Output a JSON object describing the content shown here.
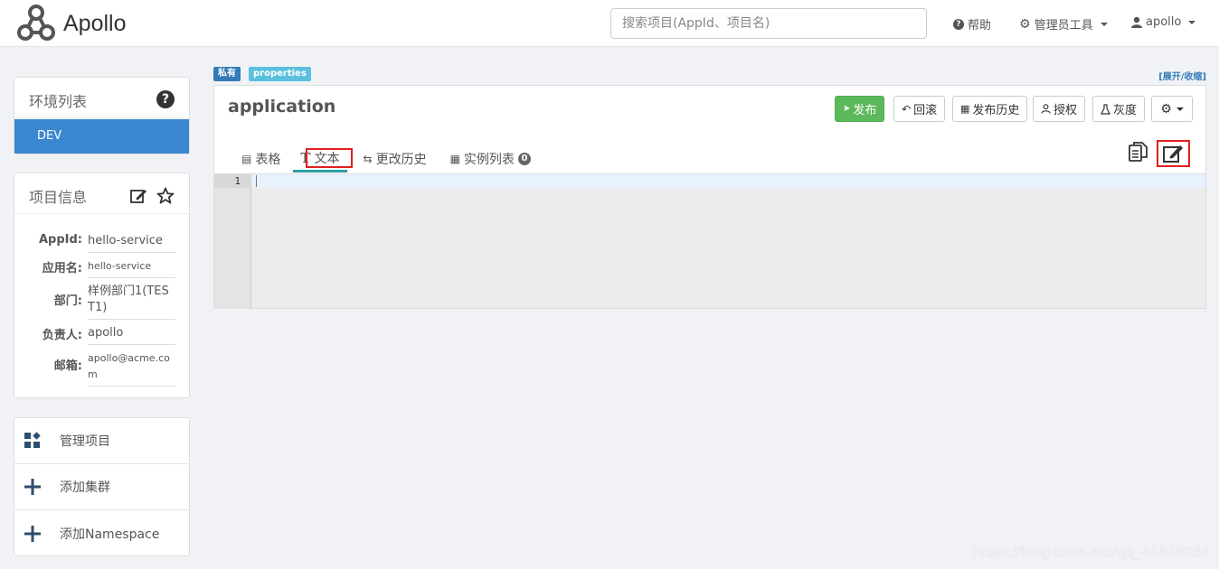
{
  "navbar": {
    "brand": "Apollo",
    "search_placeholder": "搜索项目(AppId、项目名)",
    "help": "帮助",
    "admin_tools": "管理员工具",
    "user": "apollo"
  },
  "env_panel": {
    "title": "环境列表",
    "envs": [
      {
        "label": "DEV"
      }
    ]
  },
  "info_panel": {
    "title": "项目信息",
    "rows": [
      {
        "label": "AppId:",
        "value": "hello-service"
      },
      {
        "label": "应用名:",
        "value": "hello-service"
      },
      {
        "label": "部门:",
        "value": "样例部门1(TEST1)"
      },
      {
        "label": "负责人:",
        "value": "apollo"
      },
      {
        "label": "邮箱:",
        "value": "apollo@acme.com"
      }
    ]
  },
  "actions": [
    {
      "label": "管理项目",
      "icon": "grid-diamond-icon"
    },
    {
      "label": "添加集群",
      "icon": "plus-icon"
    },
    {
      "label": "添加Namespace",
      "icon": "plus-icon"
    }
  ],
  "namespace": {
    "badge_private": "私有",
    "badge_format": "properties",
    "expand_collapse": "[展开/收缩]",
    "name": "application",
    "buttons": {
      "publish": "发布",
      "rollback": "回滚",
      "history": "发布历史",
      "grant": "授权",
      "gray": "灰度"
    },
    "tabs": {
      "table": "表格",
      "text": "文本",
      "change_history": "更改历史",
      "instances": "实例列表",
      "instance_count": "0"
    },
    "editor": {
      "line_number": "1"
    }
  },
  "watermark": "https://blog.csdn.net/qq_40378034",
  "colors": {
    "primary": "#3b88d0",
    "success": "#5cb85c",
    "highlight": "#e02020"
  }
}
